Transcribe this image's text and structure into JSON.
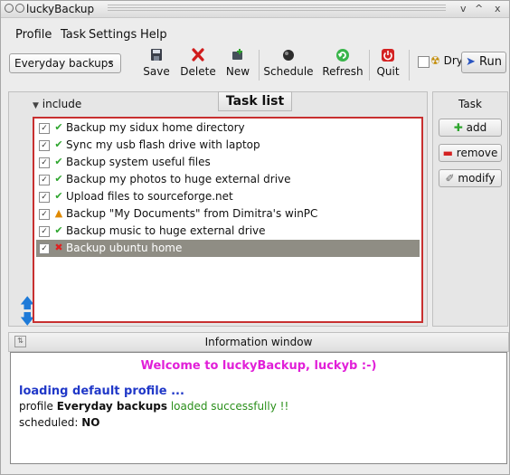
{
  "window": {
    "title": "luckyBackup",
    "controls": [
      "v",
      "^",
      "x"
    ]
  },
  "menu": {
    "profile": "Profile",
    "task": "Task",
    "settings": "Settings",
    "help": "Help"
  },
  "toolbar": {
    "profile_selected": "Everyday backups",
    "save": "Save",
    "delete": "Delete",
    "new": "New",
    "schedule": "Schedule",
    "refresh": "Refresh",
    "quit": "Quit",
    "dry": "Dry",
    "run": "Run"
  },
  "main": {
    "include_label": "include",
    "tasklist_title": "Task list",
    "tasks": [
      {
        "label": "Backup my sidux home directory",
        "checked": true,
        "status": "ok"
      },
      {
        "label": "Sync my usb flash drive with laptop",
        "checked": true,
        "status": "ok"
      },
      {
        "label": "Backup system useful files",
        "checked": true,
        "status": "ok"
      },
      {
        "label": "Backup my photos to huge external drive",
        "checked": true,
        "status": "ok"
      },
      {
        "label": "Upload files to sourceforge.net",
        "checked": true,
        "status": "ok"
      },
      {
        "label": "Backup \"My Documents\" from Dimitra's winPC",
        "checked": true,
        "status": "warning"
      },
      {
        "label": "Backup music to huge external drive",
        "checked": true,
        "status": "ok"
      },
      {
        "label": "Backup ubuntu home",
        "checked": true,
        "status": "error",
        "selected": true
      }
    ]
  },
  "task_panel": {
    "title": "Task",
    "add": "add",
    "remove": "remove",
    "modify": "modify"
  },
  "info": {
    "title": "Information window",
    "welcome": "Welcome to luckyBackup, luckyb :-)",
    "loading": "loading default profile ...",
    "profile_prefix": "profile ",
    "profile_name": "Everyday backups",
    "profile_suffix": " loaded successfully !!",
    "scheduled_label": "scheduled: ",
    "scheduled_value": "NO"
  },
  "colors": {
    "welcome": "#e11fd8",
    "loading": "#2038c8",
    "success": "#2a8f1a",
    "selected_row": "#8f8d84",
    "tasklist_border": "#c83030"
  }
}
